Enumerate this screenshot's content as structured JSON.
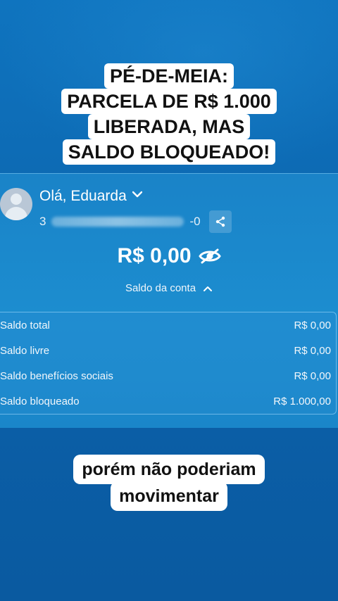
{
  "headline": {
    "lines": [
      "PÉ-DE-MEIA:",
      "PARCELA DE R$ 1.000",
      "LIBERADA, MAS",
      "SALDO BLOQUEADO!"
    ]
  },
  "account": {
    "greeting": "Olá, Eduarda",
    "number_first_char": "3",
    "number_last_chars": "-0"
  },
  "balance": {
    "amount": "R$ 0,00",
    "label": "Saldo da conta"
  },
  "balances_table": [
    {
      "label": "Saldo total",
      "value": "R$ 0,00"
    },
    {
      "label": "Saldo livre",
      "value": "R$ 0,00"
    },
    {
      "label": "Saldo benefícios sociais",
      "value": "R$ 0,00"
    },
    {
      "label": "Saldo bloqueado",
      "value": "R$ 1.000,00"
    }
  ],
  "caption": {
    "lines": [
      "porém não poderiam",
      "movimentar"
    ]
  },
  "icons": {
    "greeting_chevron": "chevron-down-icon",
    "share": "share-icon",
    "visibility": "eye-off-icon",
    "collapse": "chevron-up-icon",
    "avatar": "user-avatar"
  }
}
